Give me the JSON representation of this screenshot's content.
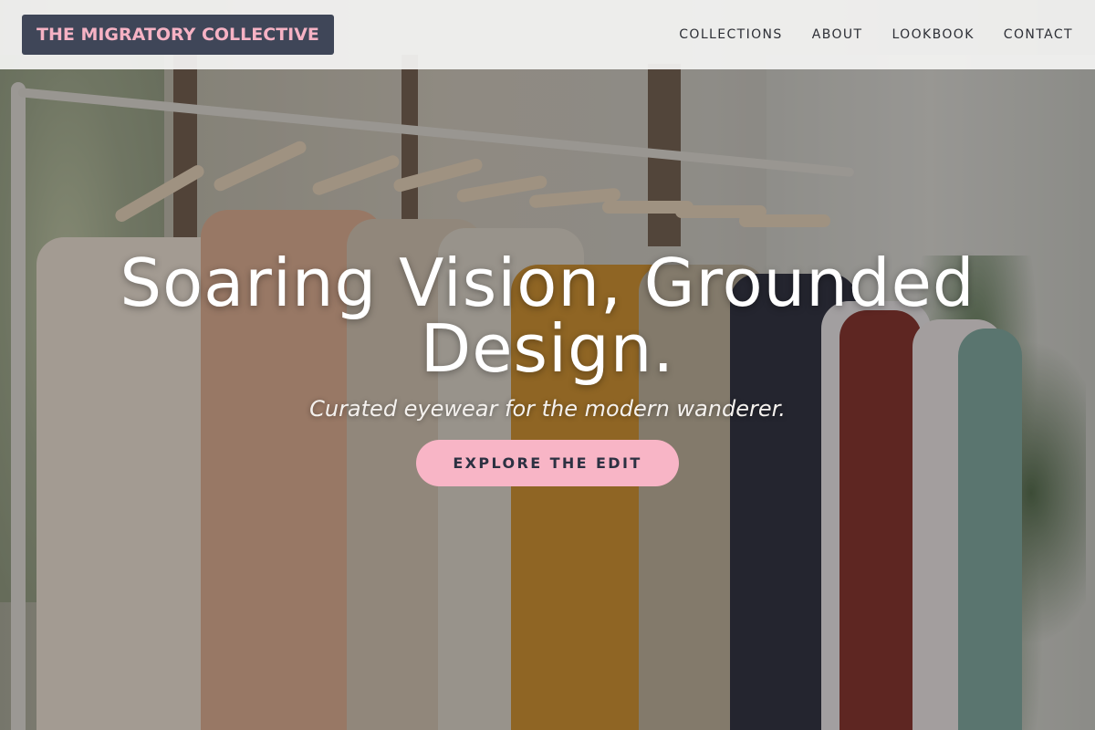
{
  "header": {
    "logo_text": "THE MIGRATORY COLLECTIVE",
    "nav": [
      {
        "label": "COLLECTIONS"
      },
      {
        "label": "ABOUT"
      },
      {
        "label": "LOOKBOOK"
      },
      {
        "label": "CONTACT"
      }
    ]
  },
  "hero": {
    "title": "Soaring Vision, Grounded Design.",
    "subtitle": "Curated eyewear for the modern wanderer.",
    "cta_label": "EXPLORE THE EDIT"
  },
  "colors": {
    "accent_pink": "#f8b5c6",
    "logo_bg": "#3f4658",
    "header_bg": "#f4f4f3",
    "nav_text": "#2d2f36"
  }
}
